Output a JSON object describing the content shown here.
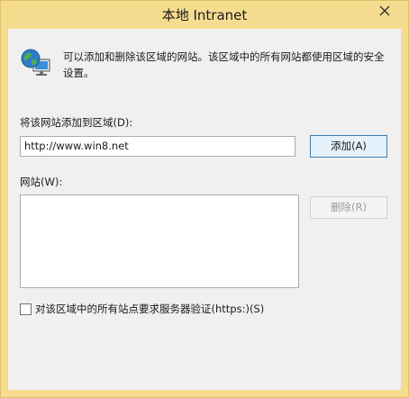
{
  "window": {
    "title": "本地 Intranet"
  },
  "info": {
    "text": "可以添加和删除该区域的网站。该区域中的所有网站都使用区域的安全设置。",
    "icon": "globe-computer-icon"
  },
  "add_site": {
    "label": "将该网站添加到区域(D):",
    "value": "http://www.win8.net",
    "add_button": "添加(A)"
  },
  "websites": {
    "label": "网站(W):",
    "items": [],
    "remove_button": "删除(R)"
  },
  "require_https": {
    "label": "对该区域中的所有站点要求服务器验证(https:)(S)",
    "checked": false
  },
  "colors": {
    "title_bar": "#f5dc8f",
    "client_bg": "#f0f0f0",
    "accent_border": "#3c7fb1"
  }
}
